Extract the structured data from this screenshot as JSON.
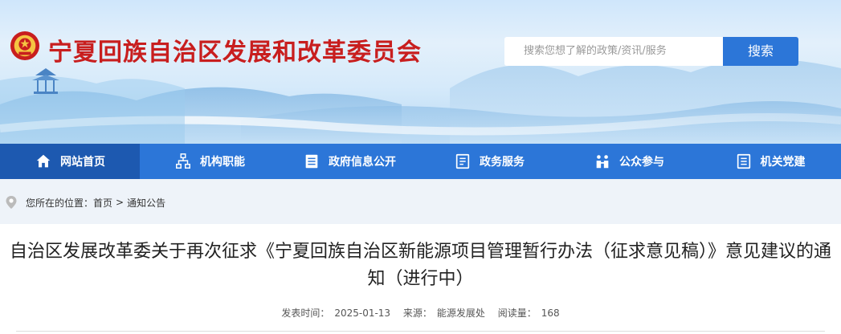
{
  "header": {
    "site_title": "宁夏回族自治区发展和改革委员会",
    "search_placeholder": "搜索您想了解的政策/资讯/服务",
    "search_button": "搜索"
  },
  "nav": {
    "items": [
      {
        "label": "网站首页",
        "icon": "home-icon"
      },
      {
        "label": "机构职能",
        "icon": "org-chart-icon"
      },
      {
        "label": "政府信息公开",
        "icon": "document-list-icon"
      },
      {
        "label": "政务服务",
        "icon": "service-doc-icon"
      },
      {
        "label": "公众参与",
        "icon": "people-icon"
      },
      {
        "label": "机关党建",
        "icon": "party-doc-icon"
      }
    ]
  },
  "breadcrumb": {
    "prefix": "您所在的位置：",
    "home": "首页",
    "separator": ">",
    "current": "通知公告"
  },
  "article": {
    "title": "自治区发展改革委关于再次征求《宁夏回族自治区新能源项目管理暂行办法（征求意见稿）》意见建议的通知（进行中）",
    "publish_label": "发表时间：",
    "publish_date": "2025-01-13",
    "source_label": "来源：",
    "source": "能源发展处",
    "views_label": "阅读量：",
    "views": "168"
  },
  "colors": {
    "nav_bg": "#2c76d8",
    "nav_active": "#1d59b0",
    "title_red": "#c81e1e"
  }
}
